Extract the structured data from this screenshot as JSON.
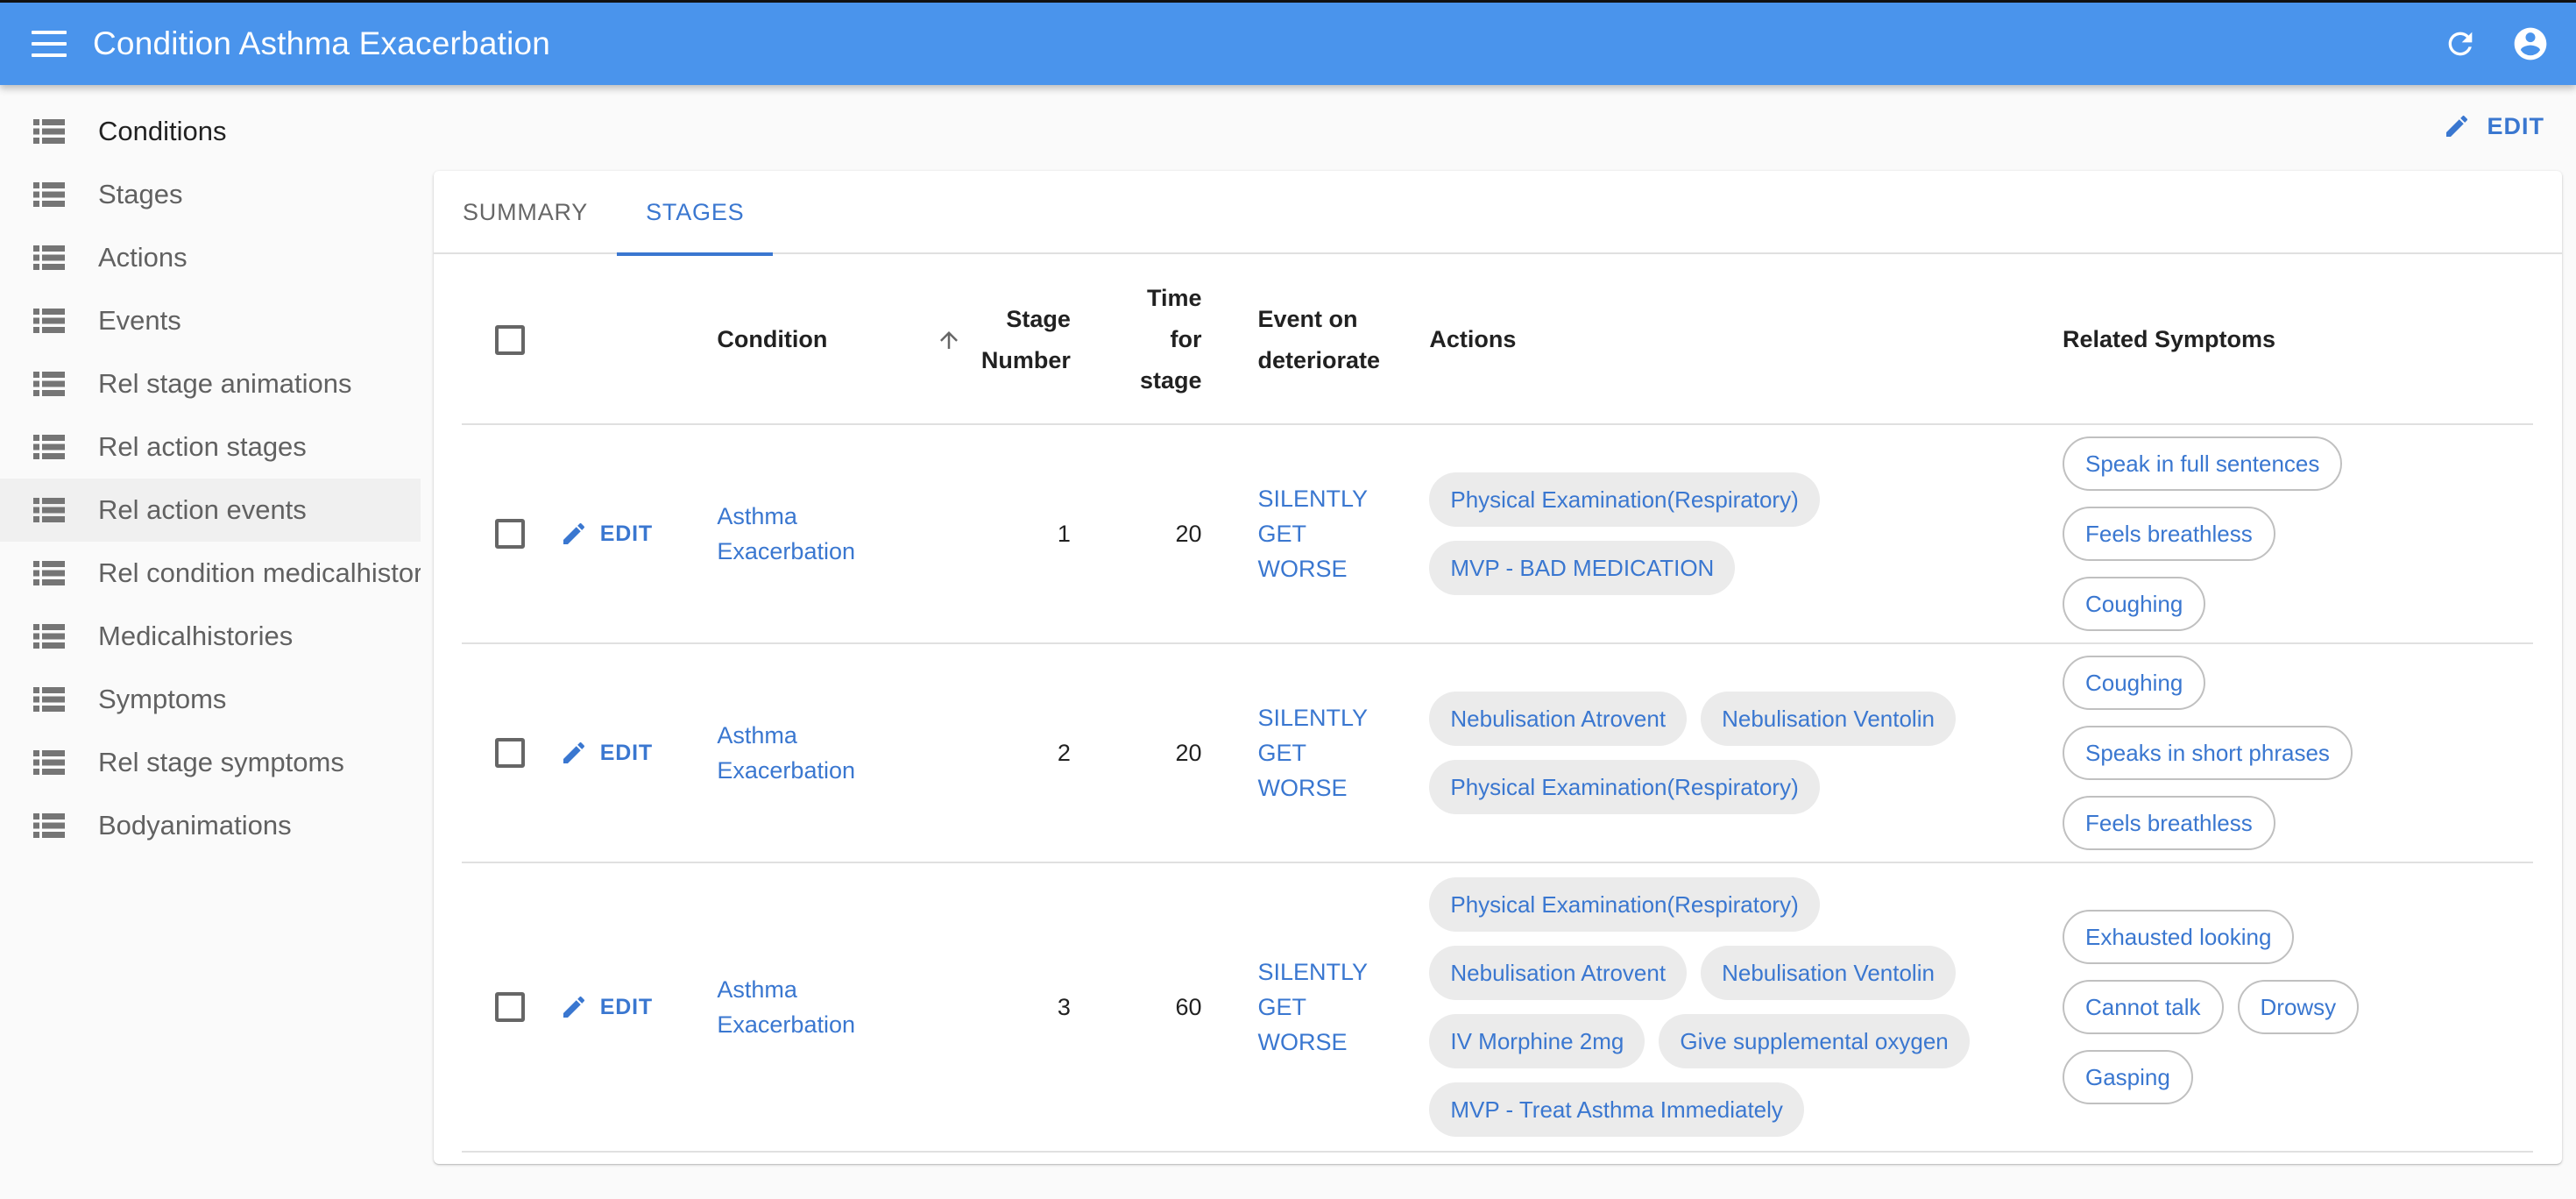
{
  "appbar": {
    "title": "Condition Asthma Exacerbation",
    "icons": {
      "menu": "menu-icon",
      "refresh": "refresh-icon",
      "account": "account-circle-icon"
    }
  },
  "sidebar": {
    "items": [
      {
        "label": "Conditions",
        "icon": "list-icon"
      },
      {
        "label": "Stages",
        "icon": "list-icon"
      },
      {
        "label": "Actions",
        "icon": "list-icon"
      },
      {
        "label": "Events",
        "icon": "list-icon"
      },
      {
        "label": "Rel stage animations",
        "icon": "list-icon"
      },
      {
        "label": "Rel action stages",
        "icon": "list-icon"
      },
      {
        "label": "Rel action events",
        "icon": "list-icon",
        "active": true
      },
      {
        "label": "Rel condition medicalhistories",
        "icon": "list-icon"
      },
      {
        "label": "Medicalhistories",
        "icon": "list-icon"
      },
      {
        "label": "Symptoms",
        "icon": "list-icon"
      },
      {
        "label": "Rel stage symptoms",
        "icon": "list-icon"
      },
      {
        "label": "Bodyanimations",
        "icon": "list-icon"
      }
    ]
  },
  "toolbar": {
    "edit_label": "EDIT"
  },
  "tabs": [
    {
      "label": "SUMMARY",
      "active": false
    },
    {
      "label": "STAGES",
      "active": true
    }
  ],
  "table": {
    "headers": {
      "condition": "Condition",
      "stage_number_1": "Stage",
      "stage_number_2": "Number",
      "time_1": "Time",
      "time_2": "for",
      "time_3": "stage",
      "event_1": "Event on",
      "event_2": "deteriorate",
      "actions": "Actions",
      "symptoms": "Related Symptoms"
    },
    "sort": {
      "column": "Stage Number",
      "direction": "ascending"
    },
    "edit_label": "EDIT",
    "rows": [
      {
        "condition_1": "Asthma",
        "condition_2": "Exacerbation",
        "stage_number": "1",
        "time_for_stage": "20",
        "event_1": "SILENTLY",
        "event_2": "GET WORSE",
        "actions": [
          "Physical Examination(Respiratory)",
          "MVP - BAD MEDICATION"
        ],
        "symptoms": [
          "Speak in full sentences",
          "Feels breathless",
          "Coughing"
        ]
      },
      {
        "condition_1": "Asthma",
        "condition_2": "Exacerbation",
        "stage_number": "2",
        "time_for_stage": "20",
        "event_1": "SILENTLY",
        "event_2": "GET WORSE",
        "actions": [
          "Nebulisation Atrovent",
          "Nebulisation Ventolin",
          "Physical Examination(Respiratory)"
        ],
        "symptoms": [
          "Coughing",
          "Speaks in short phrases",
          "Feels breathless"
        ]
      },
      {
        "condition_1": "Asthma",
        "condition_2": "Exacerbation",
        "stage_number": "3",
        "time_for_stage": "60",
        "event_1": "SILENTLY",
        "event_2": "GET WORSE",
        "actions": [
          "Physical Examination(Respiratory)",
          "Nebulisation Atrovent",
          "Nebulisation Ventolin",
          "IV Morphine 2mg",
          "Give supplemental oxygen",
          "MVP - Treat Asthma Immediately"
        ],
        "symptoms": [
          "Exhausted looking",
          "Cannot talk",
          "Drowsy",
          "Gasping"
        ]
      }
    ]
  },
  "colors": {
    "appbar": "#4a94ec",
    "accent": "#3a77d0",
    "chip_filled": "#ebebeb",
    "active_nav": "#f0f0f0"
  }
}
